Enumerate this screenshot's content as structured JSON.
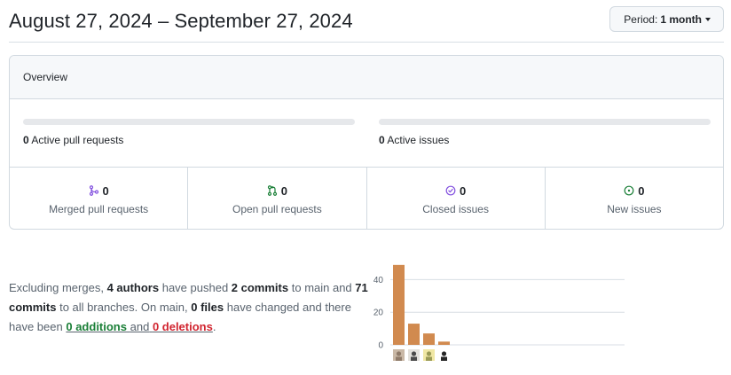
{
  "header": {
    "date_range": "August 27, 2024 – September 27, 2024",
    "period_label": "Period:",
    "period_value": "1 month"
  },
  "overview": {
    "title": "Overview",
    "pull_requests_count": "0",
    "pull_requests_label": "Active pull requests",
    "issues_count": "0",
    "issues_label": "Active issues",
    "stats": [
      {
        "count": "0",
        "label": "Merged pull requests",
        "icon": "merged-pr-icon",
        "color": "#8250df"
      },
      {
        "count": "0",
        "label": "Open pull requests",
        "icon": "open-pr-icon",
        "color": "#1a7f37"
      },
      {
        "count": "0",
        "label": "Closed issues",
        "icon": "closed-issue-icon",
        "color": "#8250df"
      },
      {
        "count": "0",
        "label": "New issues",
        "icon": "new-issue-icon",
        "color": "#1a7f37"
      }
    ]
  },
  "commits": {
    "t1": "Excluding merges,",
    "authors": "4 authors",
    "t2": "have pushed",
    "commits_main": "2 commits",
    "t3": "to main and",
    "commits_all": "71 commits",
    "t4": "to all branches. On main,",
    "files": "0 files",
    "t5": "have changed and there have been",
    "additions": "0 additions",
    "t6": "and",
    "deletions": "0 deletions",
    "t7": "."
  },
  "chart_data": {
    "type": "bar",
    "categories": [
      "author 1",
      "author 2",
      "author 3",
      "author 4"
    ],
    "values": [
      49,
      13,
      7,
      2
    ],
    "yticks": [
      0,
      20,
      40
    ],
    "ylim": [
      0,
      50
    ],
    "bar_color": "#d18a4f",
    "grid": true
  }
}
